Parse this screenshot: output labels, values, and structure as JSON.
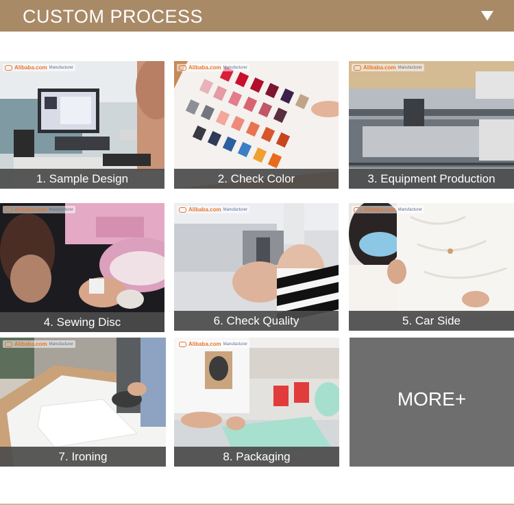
{
  "header": {
    "title": "CUSTOM PROCESS",
    "toggle_icon": "triangle-down-icon",
    "background": "#a98a67"
  },
  "logo": {
    "brand": "Alibaba.com",
    "sub": "Manufacturer"
  },
  "steps": [
    {
      "caption": "1. Sample Design"
    },
    {
      "caption": "2. Check Color"
    },
    {
      "caption": "3. Equipment Production"
    },
    {
      "caption": "4. Sewing Disc"
    },
    {
      "caption": "6. Check Quality"
    },
    {
      "caption": "5. Car Side"
    },
    {
      "caption": "7.  Ironing"
    },
    {
      "caption": "8. Packaging"
    }
  ],
  "more": {
    "label": "MORE+"
  }
}
